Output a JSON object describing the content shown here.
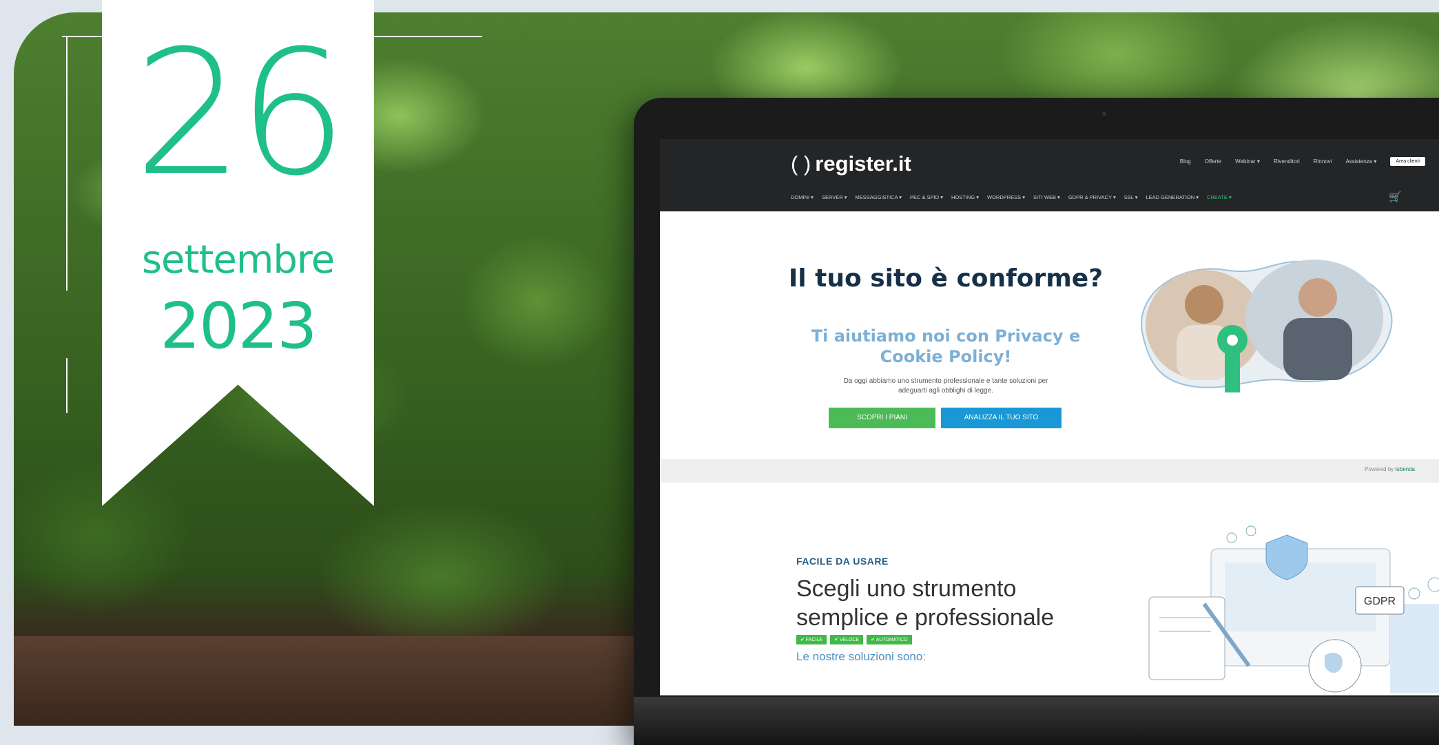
{
  "date": {
    "day": "26",
    "month": "settembre",
    "year": "2023"
  },
  "site": {
    "logo": "register.it",
    "logo_bracket": "( )",
    "topbar": [
      "Blog",
      "Offerte",
      "Webinar ▾",
      "Rivenditori",
      "Rinnovi",
      "Assistenza ▾"
    ],
    "area_clienti": "Area clienti",
    "menu": [
      "DOMINI ▾",
      "SERVER ▾",
      "MESSAGGISTICA ▾",
      "PEC & SPID ▾",
      "HOSTING ▾",
      "WORDPRESS ▾",
      "SITI WEB ▾",
      "GDPR & PRIVACY ▾",
      "SSL ▾",
      "LEAD GENERATION ▾",
      "CREATE ▾"
    ]
  },
  "privacy": {
    "headline": "Il tuo sito è conforme?",
    "subheadline": "Ti aiutiamo noi con Privacy e Cookie Policy!",
    "body": "Da oggi abbiamo uno strumento professionale e tante soluzioni per adeguarti agli obblighi di legge.",
    "btn_plans": "SCOPRI I PIANI",
    "btn_analyze": "ANALIZZA IL TUO SITO",
    "powered_by": "Powered by",
    "powered_brand": "iubenda"
  },
  "section2": {
    "eyebrow": "FACILE DA USARE",
    "title": "Scegli uno strumento semplice e professionale",
    "tags": [
      "✔ FACILE",
      "✔ VELOCE",
      "✔ AUTOMATICO"
    ],
    "subtitle": "Le nostre soluzioni sono:",
    "illustration_label": "GDPR"
  },
  "colors": {
    "accent_green": "#1fbf8a",
    "site_dark": "#232527",
    "headline_navy": "#163048",
    "sub_blue": "#7cb0d6",
    "btn_green": "#4cba56",
    "btn_blue": "#1998d5"
  }
}
